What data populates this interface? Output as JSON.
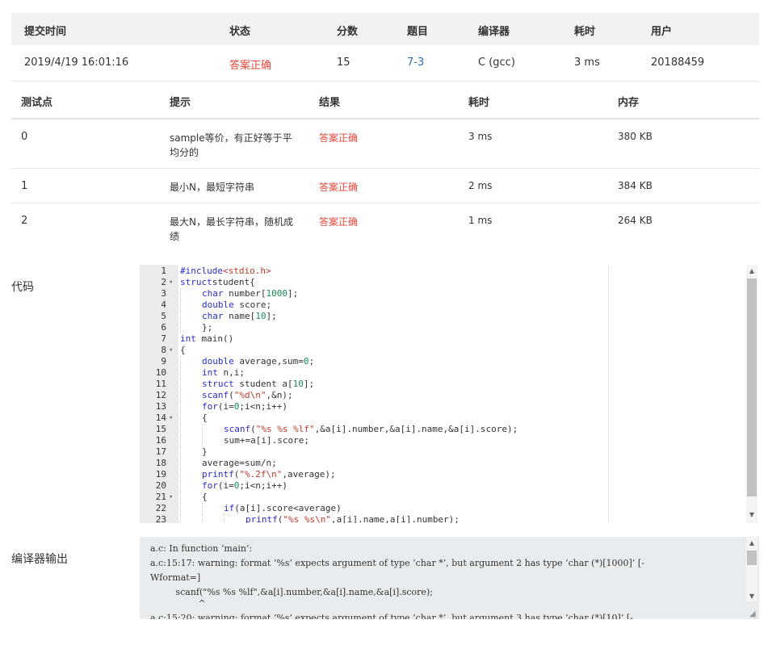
{
  "submission": {
    "headers": [
      "提交时间",
      "状态",
      "分数",
      "题目",
      "编译器",
      "耗时",
      "用户"
    ],
    "row": {
      "time": "2019/4/19 16:01:16",
      "status": "答案正确",
      "score": "15",
      "problem": "7-3",
      "compiler": "C (gcc)",
      "elapsed": "3 ms",
      "user": "20188459"
    }
  },
  "cases": {
    "headers": [
      "测试点",
      "提示",
      "结果",
      "耗时",
      "内存"
    ],
    "rows": [
      {
        "id": "0",
        "hint_line1": "sample等价，有正好等于平",
        "hint_line2": "均分的",
        "result": "答案正确",
        "time": "3 ms",
        "memory": "380 KB"
      },
      {
        "id": "1",
        "hint_line1": "最小N，最短字符串",
        "hint_line2": "",
        "result": "答案正确",
        "time": "2 ms",
        "memory": "384 KB"
      },
      {
        "id": "2",
        "hint_line1": "最大N，最长字符串，随机成",
        "hint_line2": "绩",
        "result": "答案正确",
        "time": "1 ms",
        "memory": "264 KB"
      }
    ]
  },
  "code": {
    "label": "代码",
    "lines": [
      {
        "n": "1",
        "fold": "",
        "indent": 0,
        "tokens": [
          [
            "kw",
            "#include"
          ],
          [
            "str",
            "<stdio.h>"
          ]
        ]
      },
      {
        "n": "2",
        "fold": "▾",
        "indent": 0,
        "tokens": [
          [
            "kw",
            "struct"
          ],
          [
            "",
            "student{"
          ]
        ]
      },
      {
        "n": "3",
        "fold": "",
        "indent": 1,
        "tokens": [
          [
            "kw",
            "char"
          ],
          [
            "",
            " number["
          ],
          [
            "num",
            "1000"
          ],
          [
            "",
            "];"
          ]
        ]
      },
      {
        "n": "4",
        "fold": "",
        "indent": 1,
        "tokens": [
          [
            "kw",
            "double"
          ],
          [
            "",
            " score;"
          ]
        ]
      },
      {
        "n": "5",
        "fold": "",
        "indent": 1,
        "tokens": [
          [
            "kw",
            "char"
          ],
          [
            "",
            " name["
          ],
          [
            "num",
            "10"
          ],
          [
            "",
            "];"
          ]
        ]
      },
      {
        "n": "6",
        "fold": "",
        "indent": 1,
        "tokens": [
          [
            "",
            "};"
          ]
        ]
      },
      {
        "n": "7",
        "fold": "",
        "indent": 0,
        "tokens": [
          [
            "kw",
            "int"
          ],
          [
            "",
            " main()"
          ]
        ]
      },
      {
        "n": "8",
        "fold": "▾",
        "indent": 0,
        "tokens": [
          [
            "",
            "{"
          ]
        ]
      },
      {
        "n": "9",
        "fold": "",
        "indent": 1,
        "tokens": [
          [
            "kw",
            "double"
          ],
          [
            "",
            " average,sum="
          ],
          [
            "num",
            "0"
          ],
          [
            "",
            ";"
          ]
        ]
      },
      {
        "n": "10",
        "fold": "",
        "indent": 1,
        "tokens": [
          [
            "kw",
            "int"
          ],
          [
            "",
            " n,i;"
          ]
        ]
      },
      {
        "n": "11",
        "fold": "",
        "indent": 1,
        "tokens": [
          [
            "kw",
            "struct"
          ],
          [
            "",
            " student a["
          ],
          [
            "num",
            "10"
          ],
          [
            "",
            "];"
          ]
        ]
      },
      {
        "n": "12",
        "fold": "",
        "indent": 1,
        "tokens": [
          [
            "kw",
            "scanf"
          ],
          [
            "",
            "("
          ],
          [
            "str",
            "\"%d\\n\""
          ],
          [
            "",
            ",&n);"
          ]
        ]
      },
      {
        "n": "13",
        "fold": "",
        "indent": 1,
        "tokens": [
          [
            "kw",
            "for"
          ],
          [
            "",
            "(i="
          ],
          [
            "num",
            "0"
          ],
          [
            "",
            ";i<n;i++)"
          ]
        ]
      },
      {
        "n": "14",
        "fold": "▾",
        "indent": 1,
        "tokens": [
          [
            "",
            "{"
          ]
        ]
      },
      {
        "n": "15",
        "fold": "",
        "indent": 2,
        "tokens": [
          [
            "kw",
            "scanf"
          ],
          [
            "",
            "("
          ],
          [
            "str",
            "\"%s %s %lf\""
          ],
          [
            "",
            ",&a[i].number,&a[i].name,&a[i].score);"
          ]
        ]
      },
      {
        "n": "16",
        "fold": "",
        "indent": 2,
        "tokens": [
          [
            "",
            "sum+=a[i].score;"
          ]
        ]
      },
      {
        "n": "17",
        "fold": "",
        "indent": 1,
        "tokens": [
          [
            "",
            "}"
          ]
        ]
      },
      {
        "n": "18",
        "fold": "",
        "indent": 1,
        "tokens": [
          [
            "",
            "average=sum/n;"
          ]
        ]
      },
      {
        "n": "19",
        "fold": "",
        "indent": 1,
        "tokens": [
          [
            "kw",
            "printf"
          ],
          [
            "",
            "("
          ],
          [
            "str",
            "\"%.2f\\n\""
          ],
          [
            "",
            ",average);"
          ]
        ]
      },
      {
        "n": "20",
        "fold": "",
        "indent": 1,
        "tokens": [
          [
            "kw",
            "for"
          ],
          [
            "",
            "(i="
          ],
          [
            "num",
            "0"
          ],
          [
            "",
            ";i<n;i++)"
          ]
        ]
      },
      {
        "n": "21",
        "fold": "▾",
        "indent": 1,
        "tokens": [
          [
            "",
            "{"
          ]
        ]
      },
      {
        "n": "22",
        "fold": "",
        "indent": 2,
        "tokens": [
          [
            "kw",
            "if"
          ],
          [
            "",
            "(a[i].score<average)"
          ]
        ]
      },
      {
        "n": "23",
        "fold": "",
        "indent": 3,
        "tokens": [
          [
            "kw",
            "printf"
          ],
          [
            "",
            "("
          ],
          [
            "str",
            "\"%s %s\\n\""
          ],
          [
            "",
            ",a[i].name,a[i].number);"
          ]
        ]
      }
    ]
  },
  "compiler": {
    "label": "编译器输出",
    "lines": [
      "a.c: In function ‘main’:",
      "a.c:15:17: warning: format ‘%s’ expects argument of type ‘char *’, but argument 2 has type ‘char (*)[1000]’ [-",
      "Wformat=]",
      "         scanf(\"%s %s %lf\",&a[i].number,&a[i].name,&a[i].score);",
      "                 ^",
      "a.c:15:20: warning: format ‘%s’ expects argument of type ‘char *’, but argument 3 has type ‘char (*)[10]’ [-"
    ]
  }
}
